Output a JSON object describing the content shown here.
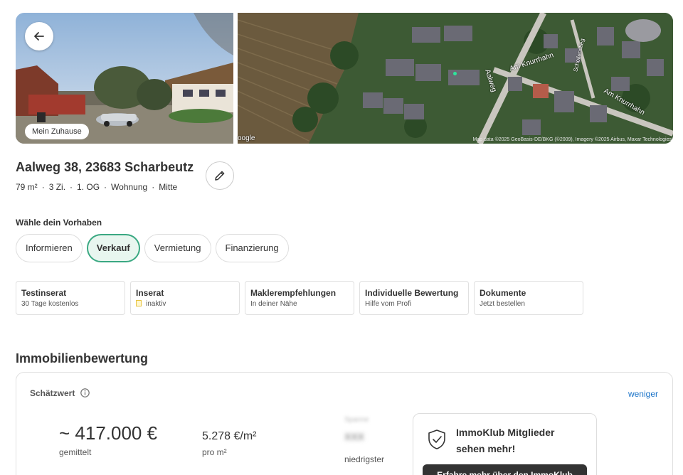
{
  "header": {
    "home_badge": "Mein Zuhause",
    "map_brand": "oogle",
    "map_attribution": "Map data ©2025 GeoBasis-DE/BKG (©2009), Imagery ©2025 Airbus, Maxar Technologies",
    "streets": [
      "Am Knurrhahn",
      "Am Knurrhahn",
      "Aalweg",
      "Schollenstieg"
    ]
  },
  "property": {
    "address": "Aalweg 38, 23683 Scharbeutz",
    "facts": [
      "79 m²",
      "3 Zi.",
      "1. OG",
      "Wohnung",
      "Mitte"
    ]
  },
  "vorhaben": {
    "label": "Wähle dein Vorhaben",
    "options": [
      {
        "label": "Informieren",
        "active": false
      },
      {
        "label": "Verkauf",
        "active": true
      },
      {
        "label": "Vermietung",
        "active": false
      },
      {
        "label": "Finanzierung",
        "active": false
      }
    ]
  },
  "cards": [
    {
      "title": "Testinserat",
      "sub": "30 Tage kostenlos"
    },
    {
      "title": "Inserat",
      "sub": "inaktiv"
    },
    {
      "title": "Maklerempfehlungen",
      "sub": "In deiner Nähe"
    },
    {
      "title": "Individuelle Bewertung",
      "sub": "Hilfe vom Profi"
    },
    {
      "title": "Dokumente",
      "sub": "Jetzt bestellen"
    }
  ],
  "valuation": {
    "section_title": "Immobilienbewertung",
    "label": "Schätzwert",
    "toggle": "weniger",
    "price": "~ 417.000 €",
    "price_sub": "gemittelt",
    "per_sqm": "5.278 €/m²",
    "per_sqm_sub": "pro m²",
    "blurred_label": "Spanne",
    "blurred_value": "XXX",
    "low_label": "niedrigster"
  },
  "club": {
    "title": "ImmoKlub Mitglieder sehen mehr!",
    "button": "Erfahre mehr über den ImmoKlub"
  },
  "colors": {
    "accent": "#3aa882",
    "link": "#1a73c8",
    "dark_button": "#333333"
  }
}
